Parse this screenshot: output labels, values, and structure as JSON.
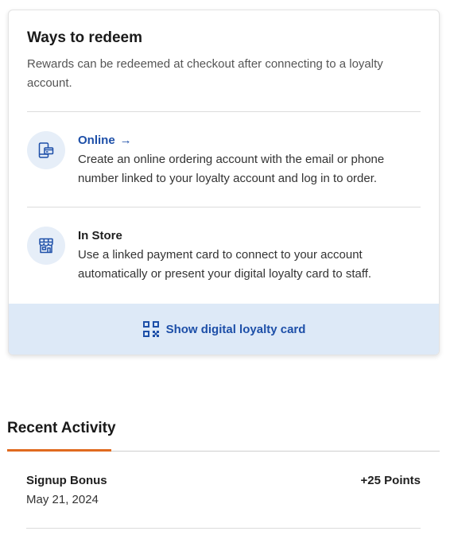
{
  "redeem": {
    "title": "Ways to redeem",
    "description": "Rewards can be redeemed at checkout after connecting to a loyalty account.",
    "methods": [
      {
        "title": "Online",
        "arrow": "→",
        "icon": "online-ordering-icon",
        "description": "Create an online ordering account with the email or phone number linked to your loyalty account and log in to order."
      },
      {
        "title": "In Store",
        "icon": "store-icon",
        "description": "Use a linked payment card to connect to your account automatically or present your digital loyalty card to staff."
      }
    ],
    "show_card_label": "Show digital loyalty card",
    "show_card_icon": "qr-code-icon"
  },
  "activity": {
    "title": "Recent Activity",
    "items": [
      {
        "name": "Signup Bonus",
        "date": "May 21, 2024",
        "points": "+25 Points"
      }
    ]
  },
  "colors": {
    "link": "#1d4fa8",
    "icon_bg": "#e6eef8",
    "show_card_bg": "#dde9f7",
    "tab_accent": "#e06a1f"
  }
}
